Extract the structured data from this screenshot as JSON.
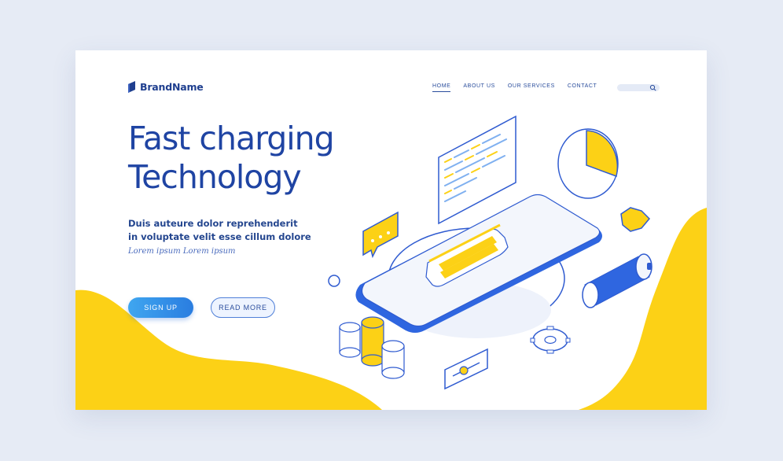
{
  "brand": {
    "name": "BrandName",
    "logo_icon": "book-logo-icon"
  },
  "nav": {
    "items": [
      {
        "label": "HOME",
        "active": true
      },
      {
        "label": "ABOUT US",
        "active": false
      },
      {
        "label": "OUR SERVICES",
        "active": false
      },
      {
        "label": "CONTACT",
        "active": false
      }
    ],
    "search_icon": "search-icon"
  },
  "hero": {
    "title_line1": "Fast charging",
    "title_line2": "Technology",
    "subtitle_line1": "Duis auteure dolor reprehenderit",
    "subtitle_line2": "in voluptate velit esse cillum dolore",
    "caption": "Lorem ipsum Lorem ipsum"
  },
  "buttons": {
    "signup": "SIGN UP",
    "read_more": "READ MORE"
  },
  "colors": {
    "page_bg": "#e6ebf5",
    "accent_yellow": "#fcd116",
    "brand_blue": "#1f44a3",
    "button_blue": "#2a7de0"
  }
}
